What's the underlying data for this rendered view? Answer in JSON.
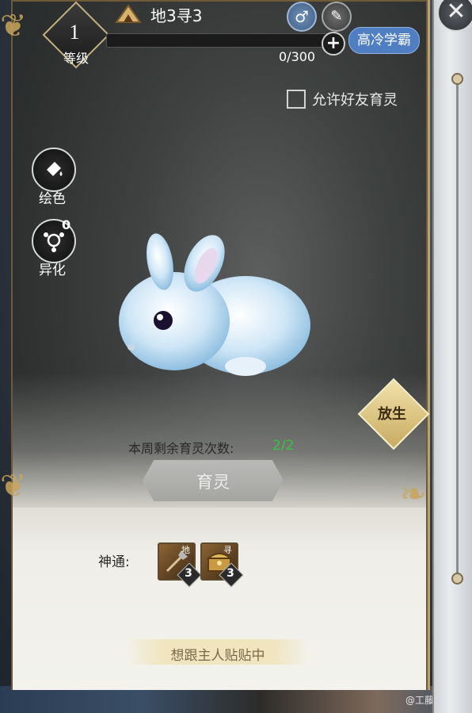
{
  "level": {
    "value": "1",
    "label": "等级"
  },
  "pet": {
    "name": "地3寻3",
    "gender_icon": "male-icon",
    "edit_icon": "edit-icon",
    "exp_text": "0/300",
    "exp_fraction": 0.0,
    "personality": "高冷学霸"
  },
  "allow_friends": {
    "label": "允许好友育灵",
    "checked": false
  },
  "side_actions": [
    {
      "label": "绘色",
      "icon": "paint-bucket-icon"
    },
    {
      "label": "异化",
      "icon": "mutation-icon",
      "count": "0"
    }
  ],
  "release_label": "放生",
  "weekly": {
    "label": "本周剩余育灵次数:",
    "value": "2/2"
  },
  "nurture_label": "育灵",
  "skills": {
    "label": "神通:",
    "items": [
      {
        "corner": "地",
        "level": "3",
        "icon": "shovel-icon"
      },
      {
        "corner": "寻",
        "level": "3",
        "icon": "treasure-chest-icon"
      }
    ]
  },
  "message": "想跟主人贴贴中",
  "watermark": "@工藤新亦",
  "colors": {
    "accent_gold": "#c9ab62",
    "tag_blue": "#4f7fc2",
    "count_green": "#39c23d"
  }
}
